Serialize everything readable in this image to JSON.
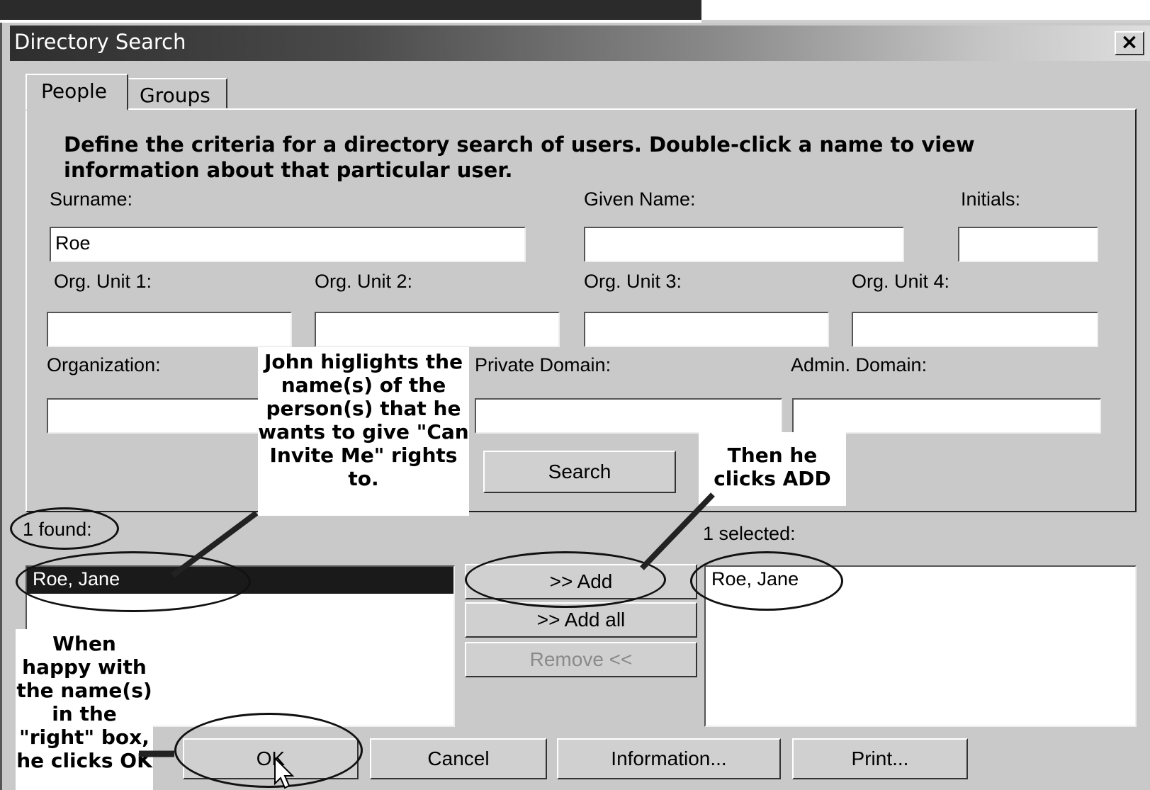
{
  "window": {
    "title": "Directory Search",
    "close_label": "×"
  },
  "tabs": [
    {
      "label": "People",
      "selected": true
    },
    {
      "label": "Groups",
      "selected": false
    }
  ],
  "description": "Define the criteria for a directory search of users. Double-click a name to view information about that particular user.",
  "fields": {
    "surname": {
      "label": "Surname:",
      "value": "Roe"
    },
    "given_name": {
      "label": "Given Name:",
      "value": ""
    },
    "initials": {
      "label": "Initials:",
      "value": ""
    },
    "org_unit_1": {
      "label": "Org. Unit 1:",
      "value": ""
    },
    "org_unit_2": {
      "label": "Org. Unit 2:",
      "value": ""
    },
    "org_unit_3": {
      "label": "Org. Unit 3:",
      "value": ""
    },
    "org_unit_4": {
      "label": "Org. Unit 4:",
      "value": ""
    },
    "organization": {
      "label": "Organization:",
      "value": ""
    },
    "private_domain": {
      "label": "Private Domain:",
      "value": ""
    },
    "admin_domain": {
      "label": "Admin. Domain:",
      "value": ""
    }
  },
  "buttons": {
    "search": "Search",
    "add": ">> Add",
    "add_all": ">> Add all",
    "remove": "Remove <<",
    "ok": "OK",
    "cancel": "Cancel",
    "information": "Information...",
    "print": "Print..."
  },
  "results": {
    "found_label": "1 found:",
    "found_items": [
      "Roe, Jane"
    ],
    "selected_label": "1 selected:",
    "selected_items": [
      "Roe, Jane"
    ]
  },
  "annotations": {
    "highlight_callout": "John higlights the name(s) of the person(s) that he wants to give \"Can Invite Me\" rights to.",
    "add_callout": "Then he clicks ADD",
    "ok_callout": "When happy with the name(s) in the \"right\" box, he clicks OK"
  },
  "colors": {
    "dialog_bg": "#c9c9c9",
    "selection_bg": "#1a1a1a",
    "annotation_ink": "#111111"
  }
}
